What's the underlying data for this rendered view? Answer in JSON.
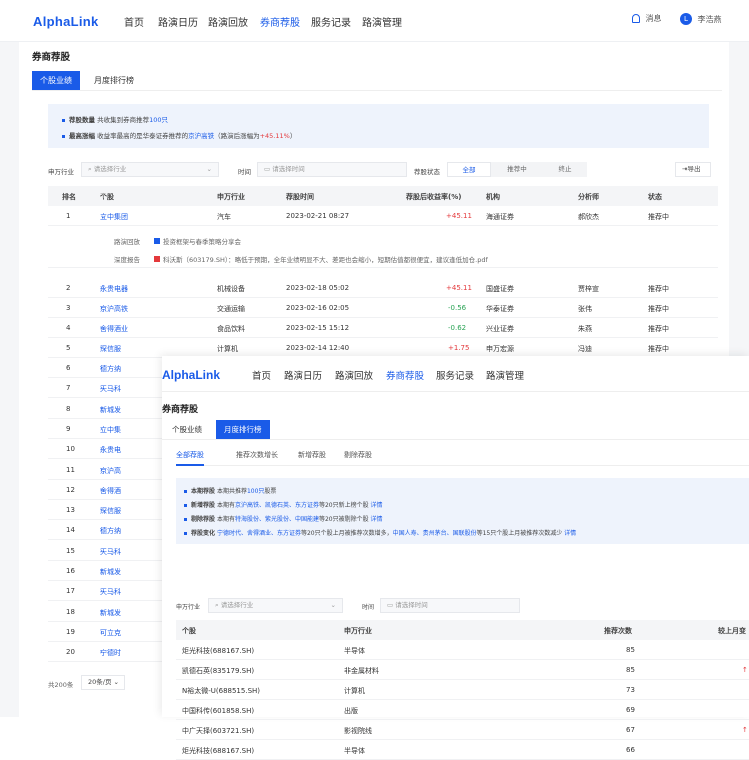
{
  "app": {
    "logo": "AlphaLink",
    "nav": [
      "首页",
      "路演日历",
      "路演回放",
      "券商荐股",
      "服务记录",
      "路演管理"
    ],
    "active_nav": "券商荐股",
    "msg": "消息",
    "user": "李浩燕",
    "avatar_letter": "L"
  },
  "page": {
    "title": "券商荐股",
    "tabs": [
      "个股业绩",
      "月度排行榜"
    ]
  },
  "notice1": {
    "l1_key": "荐股数量",
    "l1_a": "共收集到券商推荐",
    "l1_b": "100只",
    "l2_key": "最高涨幅",
    "l2_a": "收益率最高的是华泰证券推荐的",
    "l2_b": "京沪高铁",
    "l2_c": "（路演后涨幅为",
    "l2_d": "+45.11%",
    "l2_e": "）"
  },
  "filters1": {
    "industry_label": "申万行业",
    "industry_ph": "请选择行业",
    "time_label": "时间",
    "time_ph": "请选择时间",
    "status_label": "荐股状态",
    "seg": [
      "全部",
      "推荐中",
      "终止"
    ],
    "export": "导出"
  },
  "table1": {
    "headers": [
      "排名",
      "个股",
      "申万行业",
      "荐股时间",
      "荐股后收益率(%)",
      "机构",
      "分析师",
      "状态"
    ],
    "rows": [
      [
        "1",
        "立中集团",
        "汽车",
        "2023-02-21 08:27",
        "+45.11",
        "海通证券",
        "郝欣杰",
        "推荐中"
      ],
      [
        "2",
        "永贵电器",
        "机械设备",
        "2023-02-18 05:02",
        "+45.11",
        "国盛证券",
        "贾梓宣",
        "推荐中"
      ],
      [
        "3",
        "京沪高铁",
        "交通运输",
        "2023-02-16 02:05",
        "-0.56",
        "华泰证券",
        "张伟",
        "推荐中"
      ],
      [
        "4",
        "舍得酒业",
        "食品饮料",
        "2023-02-15 15:12",
        "-0.62",
        "兴业证券",
        "朱燕",
        "推荐中"
      ],
      [
        "5",
        "深信服",
        "计算机",
        "2023-02-14 12:40",
        "+1.75",
        "申万宏源",
        "冯迪",
        "推荐中"
      ]
    ],
    "more_rows": [
      [
        "6",
        "德方纳"
      ],
      [
        "7",
        "天马科"
      ],
      [
        "8",
        "新城发"
      ],
      [
        "9",
        "立中集"
      ],
      [
        "10",
        "永贵电"
      ],
      [
        "11",
        "京沪高"
      ],
      [
        "12",
        "舍得酒"
      ],
      [
        "13",
        "深信服"
      ],
      [
        "14",
        "德方纳"
      ],
      [
        "15",
        "天马科"
      ],
      [
        "16",
        "新城发"
      ],
      [
        "17",
        "天马科"
      ],
      [
        "18",
        "新城发"
      ],
      [
        "19",
        "可立克"
      ],
      [
        "20",
        "宁德时"
      ]
    ],
    "expand": {
      "roadshow_label": "路演回放",
      "roadshow_link": "投资框架与春季策略分享会",
      "report_label": "深度报告",
      "report_link": "科沃斯（603179.SH）：略低于预期，全年业绩明显不大、差距也会缩小，短期估值都很便宜，建议逢低加仓.pdf"
    }
  },
  "footer": {
    "total": "共200条",
    "page_size": "20条/页"
  },
  "overlay": {
    "logo": "AlphaLink",
    "nav": [
      "首页",
      "路演日历",
      "路演回放",
      "券商荐股",
      "服务记录",
      "路演管理"
    ],
    "active_nav": "券商荐股",
    "title": "券商荐股",
    "tabs": [
      "个股业绩",
      "月度排行榜"
    ],
    "subtabs": [
      "全部荐股",
      "推荐次数增长",
      "新增荐股",
      "剔除荐股"
    ],
    "notice": [
      {
        "key": "本期荐股",
        "text": "本期共推荐",
        "hl": "100只",
        "tail": "股票"
      },
      {
        "key": "新增荐股",
        "text": "本期有",
        "hl": "京沪高铁、凯德石英、东方证券",
        "tail": "等20只新上榜个股",
        "link": "详情"
      },
      {
        "key": "剔除荐股",
        "text": "本期有",
        "hl": "特海股份、紫光股份、中国能建",
        "tail": "等20只被剔除个股",
        "link": "详情"
      },
      {
        "key": "荐股变化",
        "text": "",
        "hl": "宁德时代、舍得酒业、东方证券",
        "tail": "等20只个股上月被推荐次数增多，",
        "hl2": "中国人寿、贵州茅台、国联股份",
        "tail2": "等15只个股上月被推荐次数减少",
        "link": "详情"
      }
    ],
    "industry_label": "申万行业",
    "industry_ph": "请选择行业",
    "time_label": "时间",
    "time_ph": "请选择时间",
    "headers": [
      "个股",
      "申万行业",
      "推荐次数",
      "较上月变"
    ],
    "rows": [
      [
        "炬光科技(688167.SH)",
        "半导体",
        "85",
        ""
      ],
      [
        "凯德石英(835179.SH)",
        "非金属材料",
        "85",
        "↑"
      ],
      [
        "N裕太微-U(688515.SH)",
        "计算机",
        "73",
        ""
      ],
      [
        "中国科传(601858.SH)",
        "出版",
        "69",
        ""
      ],
      [
        "中广天择(603721.SH)",
        "影视院线",
        "67",
        "↑"
      ],
      [
        "炬光科技(688167.SH)",
        "半导体",
        "66",
        ""
      ]
    ]
  }
}
